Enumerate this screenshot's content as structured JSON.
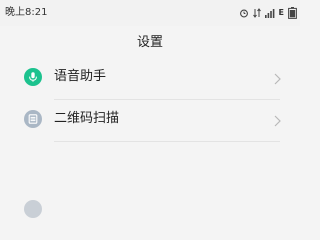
{
  "status_bar": {
    "time": "晚上8:21",
    "network_letter": "E",
    "icons": [
      "alarm-icon",
      "data-arrows-icon",
      "signal-icon",
      "network-type-e",
      "battery-icon"
    ]
  },
  "header": {
    "title": "设置"
  },
  "settings_items": [
    {
      "label": "语音助手",
      "icon": "microphone-icon",
      "icon_color": "#1cc28e"
    },
    {
      "label": "二维码扫描",
      "icon": "qr-scan-icon",
      "icon_color": "#aab7c5"
    }
  ],
  "colors": {
    "background": "#f4f4f4",
    "divider": "#e3e3e3",
    "chevron": "#b8b8b8",
    "text": "#222222"
  }
}
